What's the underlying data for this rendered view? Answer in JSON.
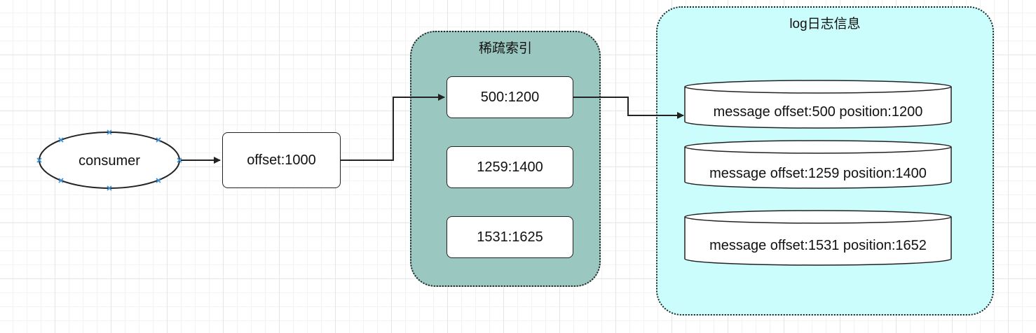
{
  "consumer": {
    "label": "consumer"
  },
  "offset_node": {
    "label": "offset:1000"
  },
  "sparse_index": {
    "title": "稀疏索引",
    "fill": "#9ac7bf",
    "entries": [
      {
        "label": "500:1200"
      },
      {
        "label": "1259:1400"
      },
      {
        "label": "1531:1625"
      }
    ]
  },
  "log_info": {
    "title": "log日志信息",
    "fill": "#ccfdfd",
    "messages": [
      {
        "label": "message offset:500 position:1200"
      },
      {
        "label": "message offset:1259 position:1400"
      },
      {
        "label": "message offset:1531 position:1652"
      }
    ]
  },
  "colors": {
    "handle": "#3a8fd8",
    "stroke": "#222222"
  }
}
